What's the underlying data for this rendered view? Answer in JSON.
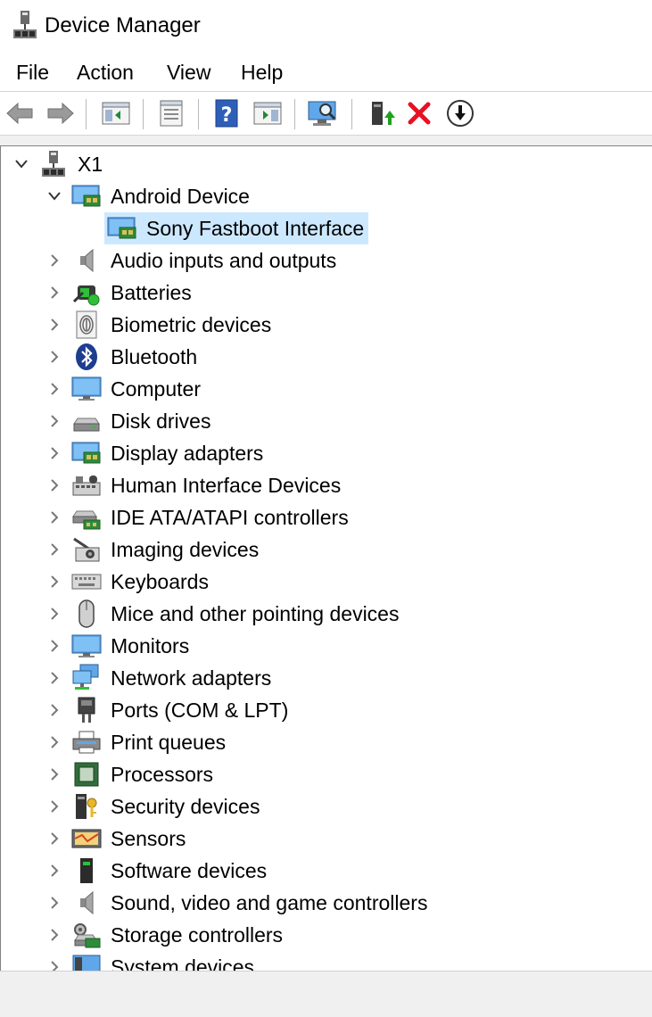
{
  "window": {
    "title": "Device Manager"
  },
  "menu": [
    {
      "key": "file",
      "label": "File"
    },
    {
      "key": "action",
      "label": "Action"
    },
    {
      "key": "view",
      "label": "View"
    },
    {
      "key": "help",
      "label": "Help"
    }
  ],
  "toolbar": {
    "buttons": [
      {
        "name": "back-arrow-icon"
      },
      {
        "name": "forward-arrow-icon"
      },
      {
        "name": "show-hide-console-tree-icon"
      },
      {
        "name": "properties-icon"
      },
      {
        "name": "help-icon"
      },
      {
        "name": "show-hide-action-pane-icon"
      },
      {
        "name": "scan-hardware-changes-icon"
      },
      {
        "name": "update-driver-icon"
      },
      {
        "name": "uninstall-device-icon"
      },
      {
        "name": "disable-device-icon"
      }
    ],
    "accent_colors": {
      "help": "#2e5fb8",
      "uninstall": "#e81123",
      "update": "#1ea21e"
    }
  },
  "tree": {
    "root": {
      "label": "X1",
      "expanded": true,
      "icon": "computer-tower-icon"
    },
    "categories": [
      {
        "label": "Android Device",
        "icon": "monitor-card-icon",
        "expanded": true,
        "children": [
          {
            "label": "Sony Fastboot Interface",
            "icon": "monitor-card-icon",
            "selected": true
          }
        ]
      },
      {
        "label": "Audio inputs and outputs",
        "icon": "speaker-icon"
      },
      {
        "label": "Batteries",
        "icon": "battery-icon"
      },
      {
        "label": "Biometric devices",
        "icon": "fingerprint-icon"
      },
      {
        "label": "Bluetooth",
        "icon": "bluetooth-icon"
      },
      {
        "label": "Computer",
        "icon": "computer-monitor-icon"
      },
      {
        "label": "Disk drives",
        "icon": "disk-drive-icon"
      },
      {
        "label": "Display adapters",
        "icon": "display-adapter-icon"
      },
      {
        "label": "Human Interface Devices",
        "icon": "hid-icon"
      },
      {
        "label": "IDE ATA/ATAPI controllers",
        "icon": "ide-controller-icon"
      },
      {
        "label": "Imaging devices",
        "icon": "camera-icon"
      },
      {
        "label": "Keyboards",
        "icon": "keyboard-icon"
      },
      {
        "label": "Mice and other pointing devices",
        "icon": "mouse-icon"
      },
      {
        "label": "Monitors",
        "icon": "monitor-icon"
      },
      {
        "label": "Network adapters",
        "icon": "network-adapter-icon"
      },
      {
        "label": "Ports (COM & LPT)",
        "icon": "port-icon"
      },
      {
        "label": "Print queues",
        "icon": "printer-icon"
      },
      {
        "label": "Processors",
        "icon": "processor-icon"
      },
      {
        "label": "Security devices",
        "icon": "security-key-icon"
      },
      {
        "label": "Sensors",
        "icon": "sensor-icon"
      },
      {
        "label": "Software devices",
        "icon": "software-device-icon"
      },
      {
        "label": "Sound, video and game controllers",
        "icon": "speaker-icon"
      },
      {
        "label": "Storage controllers",
        "icon": "storage-controller-icon"
      },
      {
        "label": "System devices",
        "icon": "system-devices-icon"
      }
    ]
  },
  "colors": {
    "selection": "#cce8ff",
    "chrome": "#f0f0f0"
  }
}
